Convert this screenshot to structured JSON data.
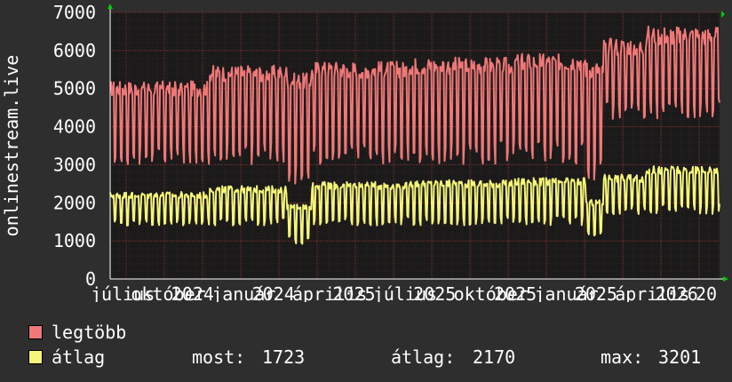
{
  "chart_data": {
    "type": "line",
    "ylabel": "onlinestream.live",
    "ylim": [
      0,
      7000
    ],
    "y_ticks": [
      "0",
      "1000",
      "2000",
      "3000",
      "4000",
      "5000",
      "6000",
      "7000"
    ],
    "x_tick_labels": [
      "július",
      "október",
      "2024",
      "január",
      "2024",
      "április",
      "2025",
      "július",
      "2025",
      "október",
      "2025",
      "január",
      "2025",
      "április",
      "2026",
      "20"
    ],
    "grid": true,
    "colors": {
      "background": "#2e2e2e",
      "plot": "#1a1a1a",
      "grid": "#5a2a2a",
      "axis": "#ffffff",
      "arrow": "#00cc00"
    },
    "series": [
      {
        "name": "legtöbb",
        "color": "#f07878",
        "segments": [
          {
            "from": 0,
            "to": 0.16,
            "mid": 5000,
            "low": 3000
          },
          {
            "from": 0.16,
            "to": 0.29,
            "mid": 5400,
            "low": 3000
          },
          {
            "from": 0.29,
            "to": 0.33,
            "mid": 5200,
            "low": 2500
          },
          {
            "from": 0.33,
            "to": 0.49,
            "mid": 5500,
            "low": 3000
          },
          {
            "from": 0.49,
            "to": 0.66,
            "mid": 5600,
            "low": 3000
          },
          {
            "from": 0.66,
            "to": 0.78,
            "mid": 5700,
            "low": 3000
          },
          {
            "from": 0.78,
            "to": 0.81,
            "mid": 5500,
            "low": 2500
          },
          {
            "from": 0.81,
            "to": 0.88,
            "mid": 6100,
            "low": 4200
          },
          {
            "from": 0.88,
            "to": 1.0,
            "mid": 6400,
            "low": 4200
          }
        ]
      },
      {
        "name": "átlag",
        "color": "#f5f57a",
        "segments": [
          {
            "from": 0,
            "to": 0.16,
            "mid": 2200,
            "low": 1400
          },
          {
            "from": 0.16,
            "to": 0.29,
            "mid": 2350,
            "low": 1400
          },
          {
            "from": 0.29,
            "to": 0.33,
            "mid": 1900,
            "low": 900
          },
          {
            "from": 0.33,
            "to": 0.49,
            "mid": 2450,
            "low": 1400
          },
          {
            "from": 0.49,
            "to": 0.66,
            "mid": 2500,
            "low": 1400
          },
          {
            "from": 0.66,
            "to": 0.78,
            "mid": 2550,
            "low": 1400
          },
          {
            "from": 0.78,
            "to": 0.81,
            "mid": 2000,
            "low": 1100
          },
          {
            "from": 0.81,
            "to": 0.88,
            "mid": 2650,
            "low": 1700
          },
          {
            "from": 0.88,
            "to": 1.0,
            "mid": 2850,
            "low": 1700
          }
        ]
      }
    ],
    "legend": [
      {
        "label": "legtöbb",
        "color": "#f07878"
      },
      {
        "label": "átlag",
        "color": "#f5f57a"
      }
    ]
  },
  "stats": {
    "most_label": "most:",
    "most_value": "1723",
    "atlag_label": "átlag:",
    "atlag_value": "2170",
    "max_label": "max:",
    "max_value": "3201"
  }
}
